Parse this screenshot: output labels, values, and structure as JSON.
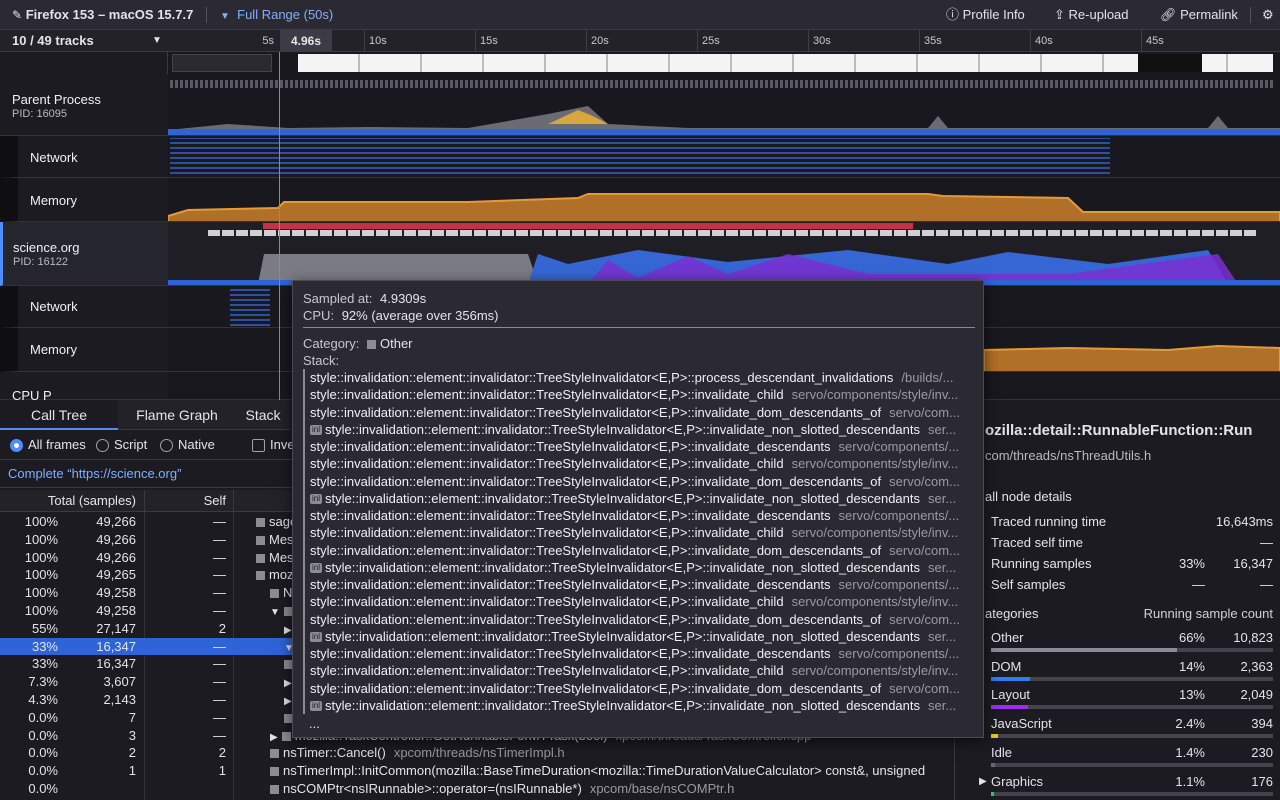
{
  "topbar": {
    "app_title": "Firefox 153 – macOS 15.7.7",
    "range_label": "Full Range (50s)",
    "profile_info": "Profile Info",
    "reupload": "Re-upload",
    "permalink": "Permalink"
  },
  "timeline": {
    "track_count": "10 / 49 tracks",
    "selection_time": "4.96s",
    "ticks": [
      "5s",
      "10s",
      "15s",
      "20s",
      "25s",
      "30s",
      "35s",
      "40s",
      "45s"
    ]
  },
  "tracks": {
    "parent_process": {
      "name": "Parent Process",
      "pid": "PID: 16095"
    },
    "parent_network": "Network",
    "parent_memory": "Memory",
    "science": {
      "name": "science.org",
      "pid": "PID: 16122"
    },
    "science_network": "Network",
    "science_memory": "Memory",
    "cpu_partial": "CPU P"
  },
  "panel": {
    "tabs": [
      "Call Tree",
      "Flame Graph",
      "Stack"
    ],
    "filters": {
      "all_frames": "All frames",
      "script": "Script",
      "native": "Native",
      "invert": "Inve"
    },
    "breadcrumb": "Complete “https://science.org”",
    "col_total": "Total (samples)",
    "col_self": "Self"
  },
  "call_tree": [
    {
      "pct": "100%",
      "samples": "49,266",
      "self": "—",
      "fn": "sageL",
      "lib": "",
      "sel": false
    },
    {
      "pct": "100%",
      "samples": "49,266",
      "self": "—",
      "fn": "Messa",
      "lib": "",
      "sel": false
    },
    {
      "pct": "100%",
      "samples": "49,266",
      "self": "—",
      "fn": "Mes",
      "lib": "",
      "sel": false
    },
    {
      "pct": "100%",
      "samples": "49,265",
      "self": "—",
      "fn": "mozi",
      "lib": "",
      "sel": false
    },
    {
      "pct": "100%",
      "samples": "49,258",
      "self": "—",
      "fn": "NS",
      "lib": "",
      "sel": false
    },
    {
      "pct": "100%",
      "samples": "49,258",
      "self": "—",
      "fn": "",
      "lib": "",
      "sel": false
    },
    {
      "pct": "55%",
      "samples": "27,147",
      "self": "2",
      "fn": "",
      "lib": "",
      "sel": false
    },
    {
      "pct": "33%",
      "samples": "16,347",
      "self": "—",
      "fn": "",
      "lib": "",
      "sel": true
    },
    {
      "pct": "33%",
      "samples": "16,347",
      "self": "—",
      "fn": "",
      "lib": "",
      "sel": false
    },
    {
      "pct": "7.3%",
      "samples": "3,607",
      "self": "—",
      "fn": "",
      "lib": "",
      "sel": false
    },
    {
      "pct": "4.3%",
      "samples": "2,143",
      "self": "—",
      "fn": "",
      "lib": "",
      "sel": false
    },
    {
      "pct": "0.0%",
      "samples": "7",
      "self": "—",
      "fn": "",
      "lib": "",
      "sel": false
    },
    {
      "pct": "0.0%",
      "samples": "3",
      "self": "—",
      "fn": "mozilla::TaskController::GetRunnableForMTTask(bool)",
      "lib": "xpcom/threads/TaskController.cpp",
      "sel": false
    },
    {
      "pct": "0.0%",
      "samples": "2",
      "self": "2",
      "fn": "nsTimer::Cancel()",
      "lib": "xpcom/threads/nsTimerImpl.h",
      "sel": false
    },
    {
      "pct": "0.0%",
      "samples": "1",
      "self": "1",
      "fn": "nsTimerImpl::InitCommon(mozilla::BaseTimeDuration<mozilla::TimeDurationValueCalculator> const&, unsigned",
      "lib": "",
      "sel": false
    },
    {
      "pct": "0.0%",
      "samples": "",
      "self": "",
      "fn": "nsCOMPtr<nsIRunnable>::operator=(nsIRunnable*)",
      "lib": "xpcom/base/nsCOMPtr.h",
      "sel": false
    }
  ],
  "tooltip": {
    "sampled_label": "Sampled at:",
    "sampled_value": "4.9309s",
    "cpu_label": "CPU:",
    "cpu_value": "92% (average over 356ms)",
    "category_label": "Category:",
    "category_value": "Other",
    "stack_label": "Stack:",
    "more": "...",
    "stack": [
      {
        "fn": "style::invalidation::element::invalidator::TreeStyleInvalidator<E,P>::process_descendant_invalidations",
        "path": "/builds/...",
        "inl": false
      },
      {
        "fn": "style::invalidation::element::invalidator::TreeStyleInvalidator<E,P>::invalidate_child",
        "path": "servo/components/style/inv...",
        "inl": false
      },
      {
        "fn": "style::invalidation::element::invalidator::TreeStyleInvalidator<E,P>::invalidate_dom_descendants_of",
        "path": "servo/com...",
        "inl": false
      },
      {
        "fn": "style::invalidation::element::invalidator::TreeStyleInvalidator<E,P>::invalidate_non_slotted_descendants",
        "path": "ser...",
        "inl": true
      },
      {
        "fn": "style::invalidation::element::invalidator::TreeStyleInvalidator<E,P>::invalidate_descendants",
        "path": "servo/components/...",
        "inl": false
      },
      {
        "fn": "style::invalidation::element::invalidator::TreeStyleInvalidator<E,P>::invalidate_child",
        "path": "servo/components/style/inv...",
        "inl": false
      },
      {
        "fn": "style::invalidation::element::invalidator::TreeStyleInvalidator<E,P>::invalidate_dom_descendants_of",
        "path": "servo/com...",
        "inl": false
      },
      {
        "fn": "style::invalidation::element::invalidator::TreeStyleInvalidator<E,P>::invalidate_non_slotted_descendants",
        "path": "ser...",
        "inl": true
      },
      {
        "fn": "style::invalidation::element::invalidator::TreeStyleInvalidator<E,P>::invalidate_descendants",
        "path": "servo/components/...",
        "inl": false
      },
      {
        "fn": "style::invalidation::element::invalidator::TreeStyleInvalidator<E,P>::invalidate_child",
        "path": "servo/components/style/inv...",
        "inl": false
      },
      {
        "fn": "style::invalidation::element::invalidator::TreeStyleInvalidator<E,P>::invalidate_dom_descendants_of",
        "path": "servo/com...",
        "inl": false
      },
      {
        "fn": "style::invalidation::element::invalidator::TreeStyleInvalidator<E,P>::invalidate_non_slotted_descendants",
        "path": "ser...",
        "inl": true
      },
      {
        "fn": "style::invalidation::element::invalidator::TreeStyleInvalidator<E,P>::invalidate_descendants",
        "path": "servo/components/...",
        "inl": false
      },
      {
        "fn": "style::invalidation::element::invalidator::TreeStyleInvalidator<E,P>::invalidate_child",
        "path": "servo/components/style/inv...",
        "inl": false
      },
      {
        "fn": "style::invalidation::element::invalidator::TreeStyleInvalidator<E,P>::invalidate_dom_descendants_of",
        "path": "servo/com...",
        "inl": false
      },
      {
        "fn": "style::invalidation::element::invalidator::TreeStyleInvalidator<E,P>::invalidate_non_slotted_descendants",
        "path": "ser...",
        "inl": true
      },
      {
        "fn": "style::invalidation::element::invalidator::TreeStyleInvalidator<E,P>::invalidate_descendants",
        "path": "servo/components/...",
        "inl": false
      },
      {
        "fn": "style::invalidation::element::invalidator::TreeStyleInvalidator<E,P>::invalidate_child",
        "path": "servo/components/style/inv...",
        "inl": false
      },
      {
        "fn": "style::invalidation::element::invalidator::TreeStyleInvalidator<E,P>::invalidate_dom_descendants_of",
        "path": "servo/com...",
        "inl": false
      },
      {
        "fn": "style::invalidation::element::invalidator::TreeStyleInvalidator<E,P>::invalidate_non_slotted_descendants",
        "path": "ser...",
        "inl": true
      }
    ]
  },
  "sidebar": {
    "title": "ozilla::detail::RunnableFunction::Run",
    "file": "com/threads/nsThreadUtils.h",
    "section_details": "all node details",
    "traced_running": {
      "label": "Traced running time",
      "value": "16,643ms"
    },
    "traced_self": {
      "label": "Traced self time",
      "value": "—"
    },
    "running_samples": {
      "label": "Running samples",
      "pct": "33%",
      "value": "16,347"
    },
    "self_samples": {
      "label": "Self samples",
      "pct": "—",
      "value": "—"
    },
    "categories_header": "ategories",
    "count_header": "Running sample count",
    "categories": [
      {
        "name": "Other",
        "pct": "66%",
        "count": "10,823",
        "fraction": 0.66,
        "color": "#8c8c94"
      },
      {
        "name": "DOM",
        "pct": "14%",
        "count": "2,363",
        "fraction": 0.14,
        "color": "#2f7bf0"
      },
      {
        "name": "Layout",
        "pct": "13%",
        "count": "2,049",
        "fraction": 0.13,
        "color": "#9b2ef0"
      },
      {
        "name": "JavaScript",
        "pct": "2.4%",
        "count": "394",
        "fraction": 0.024,
        "color": "#e8c42a"
      },
      {
        "name": "Idle",
        "pct": "1.4%",
        "count": "230",
        "fraction": 0.014,
        "color": "#6a6a72"
      },
      {
        "name": "Graphics",
        "pct": "1.1%",
        "count": "176",
        "fraction": 0.011,
        "color": "#35c06a"
      }
    ]
  },
  "colors": {
    "accent": "#4f8cff",
    "memory": "#e39b3a",
    "selection": "#2f64d6"
  }
}
